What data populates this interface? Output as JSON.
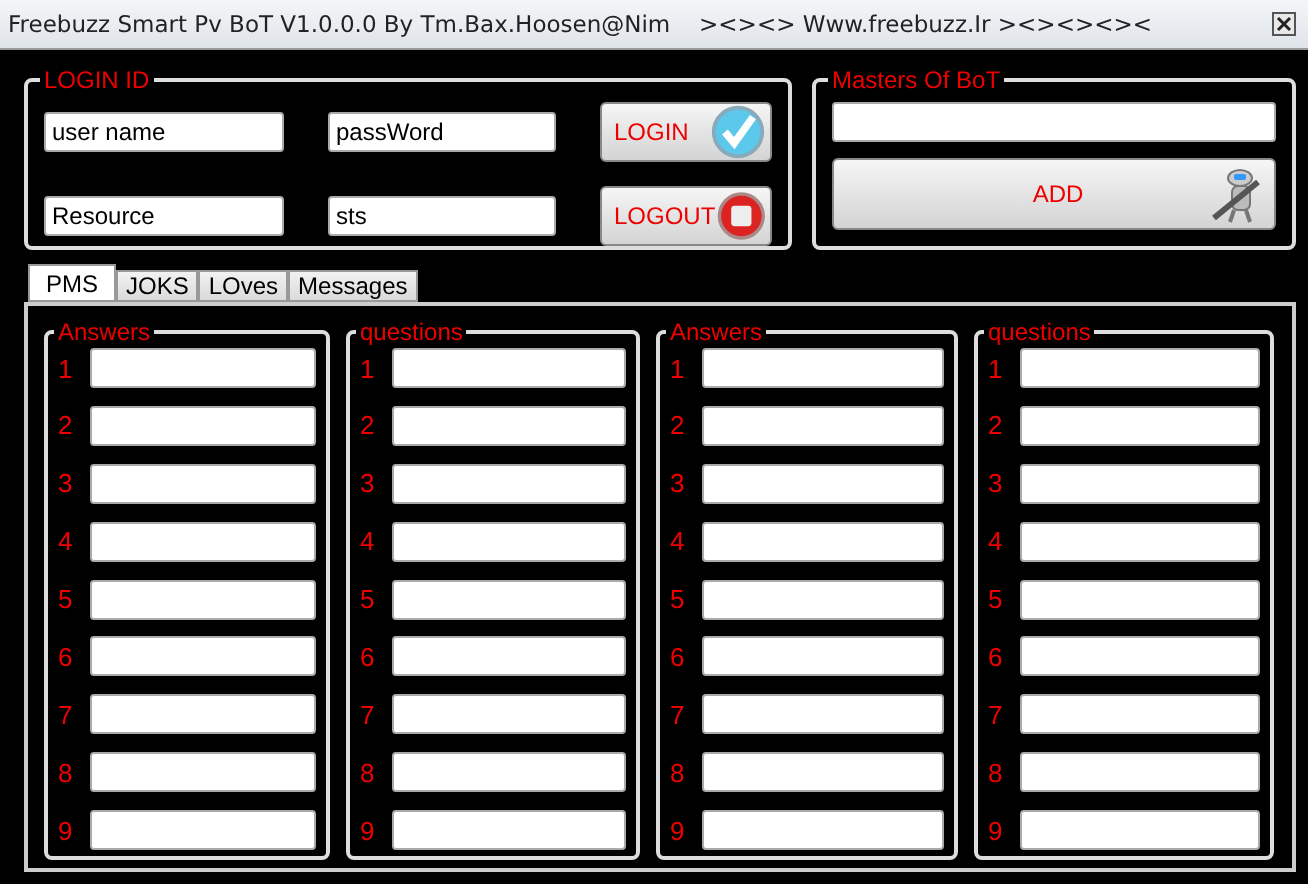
{
  "window": {
    "title": "Freebuzz Smart Pv BoT V1.0.0.0 By Tm.Bax.Hoosen@Nim",
    "title_right": "><><> Www.freebuzz.Ir ><><><><"
  },
  "login": {
    "title": "LOGIN ID",
    "fields": [
      {
        "value": "user name"
      },
      {
        "value": "passWord"
      },
      {
        "value": "Resource"
      },
      {
        "value": "sts"
      }
    ],
    "buttons": [
      {
        "label": "LOGIN",
        "kind": "check"
      },
      {
        "label": "LOGOUT",
        "kind": "stop"
      }
    ]
  },
  "masters": {
    "title": "Masters Of BoT",
    "button": "ADD"
  },
  "tabs": [
    {
      "label": "PMS",
      "selected": true
    },
    {
      "label": "JOKS",
      "selected": false
    },
    {
      "label": "LOves",
      "selected": false
    },
    {
      "label": "Messages",
      "selected": false
    }
  ],
  "groups": [
    {
      "title": "Answers",
      "rows": [
        "1",
        "2",
        "3",
        "4",
        "5",
        "6",
        "7",
        "8",
        "9"
      ]
    },
    {
      "title": "questions",
      "rows": [
        "1",
        "2",
        "3",
        "4",
        "5",
        "6",
        "7",
        "8",
        "9"
      ]
    },
    {
      "title": "Answers",
      "rows": [
        "1",
        "2",
        "3",
        "4",
        "5",
        "6",
        "7",
        "8",
        "9"
      ]
    },
    {
      "title": "questions",
      "rows": [
        "1",
        "2",
        "3",
        "4",
        "5",
        "6",
        "7",
        "8",
        "9"
      ]
    }
  ]
}
